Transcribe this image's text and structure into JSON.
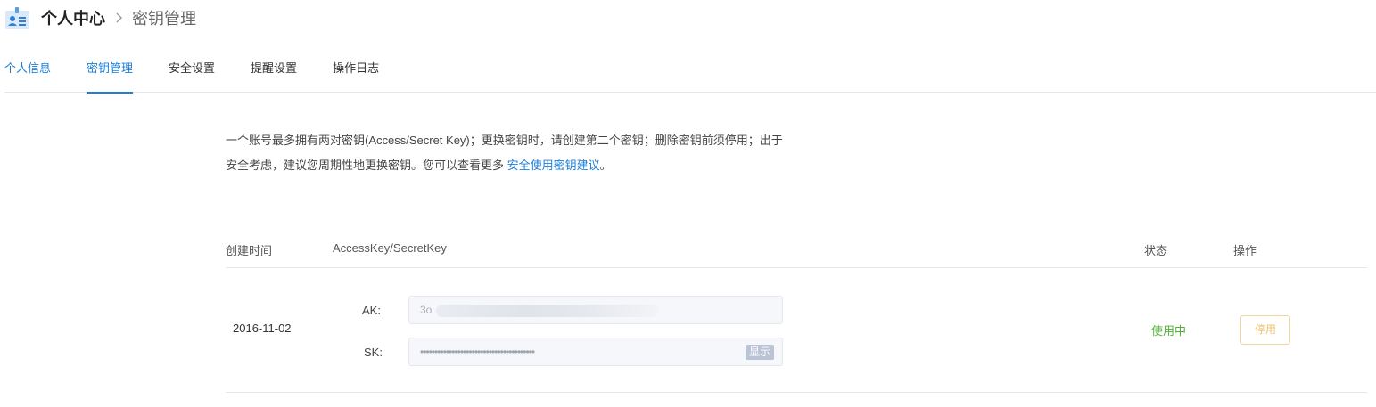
{
  "breadcrumb": {
    "root": "个人中心",
    "current": "密钥管理"
  },
  "tabs": [
    {
      "label": "个人信息"
    },
    {
      "label": "密钥管理"
    },
    {
      "label": "安全设置"
    },
    {
      "label": "提醒设置"
    },
    {
      "label": "操作日志"
    }
  ],
  "description": {
    "text": "一个账号最多拥有两对密钥(Access/Secret Key)；更换密钥时，请创建第二个密钥；删除密钥前须停用；出于安全考虑，建议您周期性地更换密钥。您可以查看更多 ",
    "link": "安全使用密钥建议",
    "end": "。"
  },
  "table": {
    "headers": {
      "created": "创建时间",
      "keys": "AccessKey/SecretKey",
      "status": "状态",
      "action": "操作"
    },
    "rows": [
      {
        "created": "2016-11-02",
        "ak_label": "AK:",
        "ak_value": "3o",
        "ak_value_tail": "Pb",
        "sk_label": "SK:",
        "sk_value": "••••••••••••••••••••••••••••••••••••••••",
        "show_label": "显示",
        "status": "使用中",
        "action_label": "停用"
      }
    ]
  },
  "colors": {
    "accent": "#1c7ed6",
    "status_active": "#52b036",
    "warning_outline": "#f3d59a"
  }
}
